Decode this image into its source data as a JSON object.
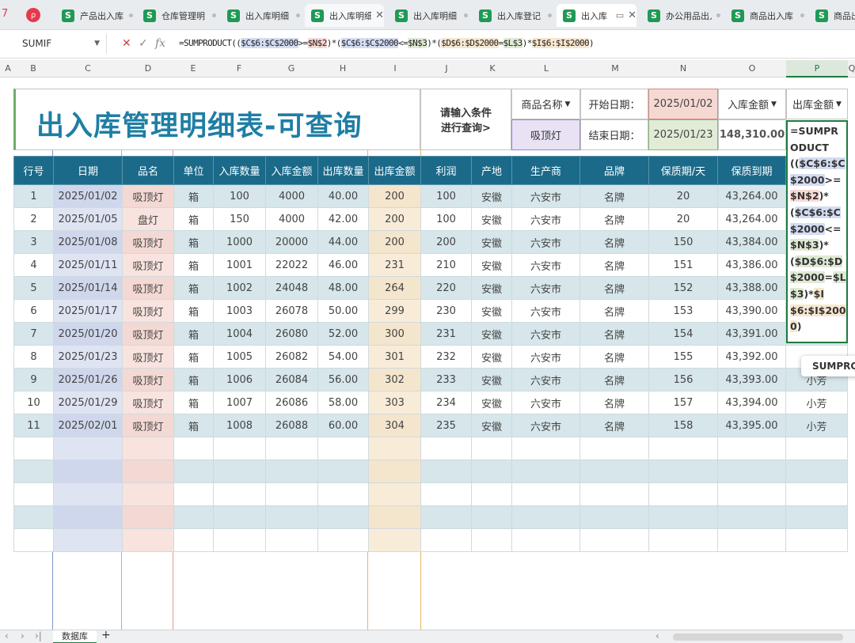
{
  "tabs": [
    {
      "label": "产品出入库"
    },
    {
      "label": "仓库管理明"
    },
    {
      "label": "出入库明细"
    },
    {
      "label": "出入库明细"
    },
    {
      "label": "出入库明细"
    },
    {
      "label": "出入库登记"
    },
    {
      "label": "出入库"
    },
    {
      "label": "办公用品出入"
    },
    {
      "label": "商品出入库"
    },
    {
      "label": "商品出"
    }
  ],
  "formula_bar": {
    "name_box": "SUMIF",
    "fx": "fx",
    "parts": [
      "=SUMPRODUCT((",
      "$C$6:$C$2000",
      ">=",
      "$N$2",
      ")*(",
      "$C$6:$C$2000",
      "<=",
      "$N$3",
      ")*(",
      "$D$6:$D$2000",
      "=",
      "$L$3",
      ")*",
      "$I$6:$I$2000",
      ")"
    ]
  },
  "columns": [
    "A",
    "B",
    "C",
    "D",
    "E",
    "F",
    "G",
    "H",
    "I",
    "J",
    "K",
    "L",
    "M",
    "N",
    "O",
    "P",
    "Q"
  ],
  "header": {
    "title": "出入库管理明细表-可查询",
    "hint_line1": "请输入条件",
    "hint_line2": "进行查询>",
    "product_label": "商品名称",
    "product_value": "吸顶灯",
    "start_label": "开始日期：",
    "start_value": "2025/01/02",
    "end_label": "结束日期：",
    "end_value": "2025/01/23",
    "in_amount_label": "入库金额",
    "in_amount_value": "148,310.00",
    "out_amount_label": "出库金额"
  },
  "formula_popup": {
    "parts": [
      "=SUMPR",
      "ODUCT((",
      "$C$6:$C$2",
      "000",
      ">=",
      "$N$2",
      ")*(",
      "$C$6:$C$2",
      "000",
      "<=",
      "$N$3",
      ")*(",
      "$D$6:$D$",
      "2000",
      "=",
      "$L$3",
      ")*",
      "$I$6:$I$20",
      "00",
      ")"
    ],
    "tooltip": "SUMPRODUCT"
  },
  "table": {
    "headers": [
      "行号",
      "日期",
      "品名",
      "单位",
      "入库数量",
      "入库金额",
      "出库数量",
      "出库金额",
      "利润",
      "产地",
      "生产商",
      "品牌",
      "保质期/天",
      "保质到期",
      ""
    ],
    "rows": [
      [
        "1",
        "2025/01/02",
        "吸顶灯",
        "箱",
        "100",
        "4000",
        "40.00",
        "200",
        "100",
        "安徽",
        "六安市",
        "名牌",
        "20",
        "43,264.00",
        ""
      ],
      [
        "2",
        "2025/01/05",
        "盘灯",
        "箱",
        "150",
        "4000",
        "42.00",
        "200",
        "100",
        "安徽",
        "六安市",
        "名牌",
        "20",
        "43,264.00",
        ""
      ],
      [
        "3",
        "2025/01/08",
        "吸顶灯",
        "箱",
        "1000",
        "20000",
        "44.00",
        "200",
        "200",
        "安徽",
        "六安市",
        "名牌",
        "150",
        "43,384.00",
        ""
      ],
      [
        "4",
        "2025/01/11",
        "吸顶灯",
        "箱",
        "1001",
        "22022",
        "46.00",
        "231",
        "210",
        "安徽",
        "六安市",
        "名牌",
        "151",
        "43,386.00",
        ""
      ],
      [
        "5",
        "2025/01/14",
        "吸顶灯",
        "箱",
        "1002",
        "24048",
        "48.00",
        "264",
        "220",
        "安徽",
        "六安市",
        "名牌",
        "152",
        "43,388.00",
        ""
      ],
      [
        "6",
        "2025/01/17",
        "吸顶灯",
        "箱",
        "1003",
        "26078",
        "50.00",
        "299",
        "230",
        "安徽",
        "六安市",
        "名牌",
        "153",
        "43,390.00",
        ""
      ],
      [
        "7",
        "2025/01/20",
        "吸顶灯",
        "箱",
        "1004",
        "26080",
        "52.00",
        "300",
        "231",
        "安徽",
        "六安市",
        "名牌",
        "154",
        "43,391.00",
        ""
      ],
      [
        "8",
        "2025/01/23",
        "吸顶灯",
        "箱",
        "1005",
        "26082",
        "54.00",
        "301",
        "232",
        "安徽",
        "六安市",
        "名牌",
        "155",
        "43,392.00",
        ""
      ],
      [
        "9",
        "2025/01/26",
        "吸顶灯",
        "箱",
        "1006",
        "26084",
        "56.00",
        "302",
        "233",
        "安徽",
        "六安市",
        "名牌",
        "156",
        "43,393.00",
        "小芳"
      ],
      [
        "10",
        "2025/01/29",
        "吸顶灯",
        "箱",
        "1007",
        "26086",
        "58.00",
        "303",
        "234",
        "安徽",
        "六安市",
        "名牌",
        "157",
        "43,394.00",
        "小芳"
      ],
      [
        "11",
        "2025/02/01",
        "吸顶灯",
        "箱",
        "1008",
        "26088",
        "60.00",
        "304",
        "235",
        "安徽",
        "六安市",
        "名牌",
        "158",
        "43,395.00",
        "小芳"
      ]
    ],
    "empty_rows": 5
  },
  "sheet_tab": "数据库",
  "add_sheet": "+",
  "colors": {
    "header_blue": "#1b6a8a",
    "title_blue": "#1f7ea4",
    "excel_green": "#1e7a40"
  }
}
